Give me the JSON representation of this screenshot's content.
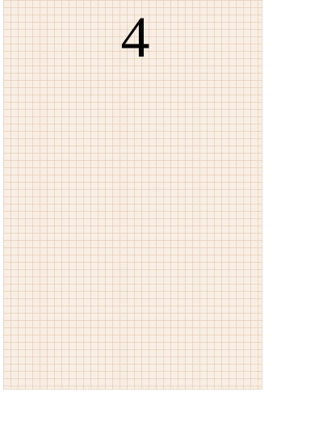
{
  "page": {
    "number": "4",
    "paper_color": "#f8eee4",
    "grid_color": "#dec4ac",
    "style": "graph-paper"
  }
}
